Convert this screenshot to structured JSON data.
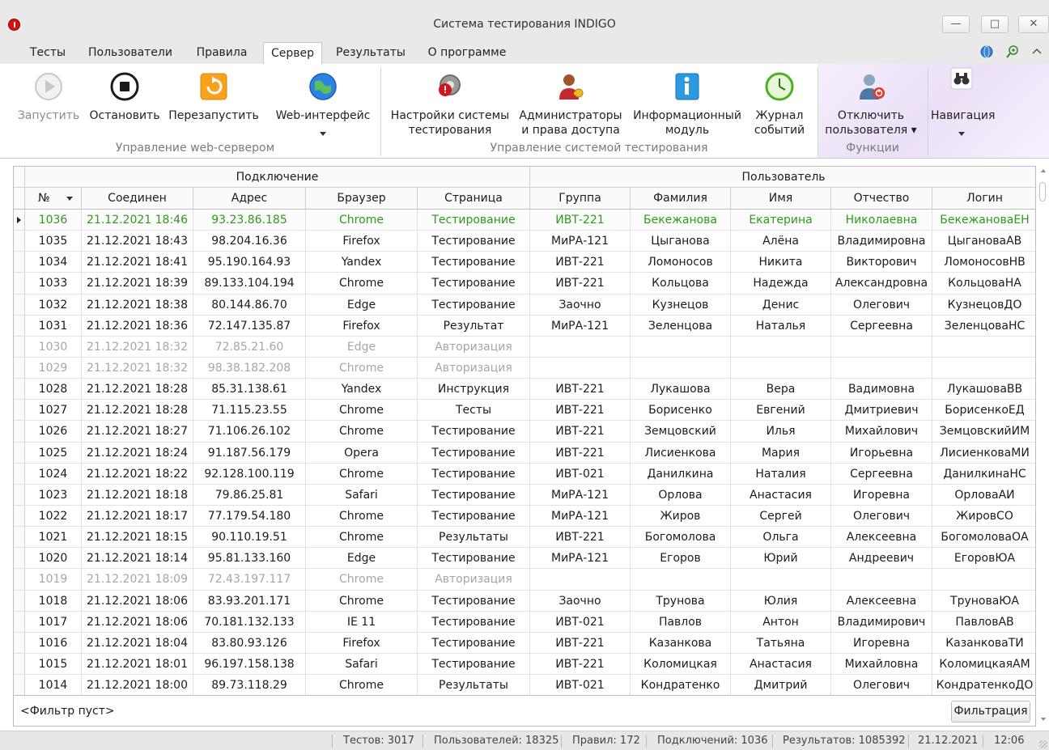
{
  "window": {
    "title": "Система тестирования INDIGO",
    "min_glyph": "—",
    "max_glyph": "□",
    "close_glyph": "✕"
  },
  "tabs": [
    {
      "label": "Тесты",
      "active": false
    },
    {
      "label": "Пользователи",
      "active": false
    },
    {
      "label": "Правила",
      "active": false
    },
    {
      "label": "Сервер",
      "active": true
    },
    {
      "label": "Результаты",
      "active": false
    },
    {
      "label": "О программе",
      "active": false
    }
  ],
  "ribbon": {
    "groups": {
      "web_server": "Управление web-сервером",
      "testing_system": "Управление системой тестирования",
      "functions": "Функции"
    },
    "buttons": {
      "start": "Запустить",
      "stop": "Остановить",
      "restart": "Перезапустить",
      "web": "Web-интерфейс",
      "settings_l1": "Настройки системы",
      "settings_l2": "тестирования",
      "admins_l1": "Администраторы",
      "admins_l2": "и права доступа",
      "info_l1": "Информационный",
      "info_l2": "модуль",
      "journal_l1": "Журнал",
      "journal_l2": "событий",
      "disconnect_l1": "Отключить",
      "disconnect_l2": "пользователя",
      "nav": "Навигация"
    },
    "icons": {
      "start": "play-icon",
      "stop": "stop-icon",
      "restart": "restart-icon",
      "web": "globe-icon",
      "settings": "settings-gear-icon",
      "admins": "admin-key-icon",
      "info": "info-icon",
      "journal": "clock-icon",
      "disconnect": "user-disconnect-icon",
      "nav": "binoculars-icon"
    }
  },
  "grid": {
    "bands": {
      "connection": "Подключение",
      "user": "Пользователь"
    },
    "columns": {
      "num": "№",
      "connected": "Соединен",
      "address": "Адрес",
      "browser": "Браузер",
      "page": "Страница",
      "group": "Группа",
      "surname": "Фамилия",
      "name": "Имя",
      "patronymic": "Отчество",
      "login": "Логин"
    },
    "rows": [
      {
        "state": "active",
        "num": "1036",
        "connected": "21.12.2021 18:46",
        "address": "93.23.86.185",
        "browser": "Chrome",
        "page": "Тестирование",
        "group": "ИВТ-221",
        "surname": "Бекежанова",
        "name": "Екатерина",
        "patronymic": "Николаевна",
        "login": "БекежановаЕН"
      },
      {
        "state": "normal",
        "num": "1035",
        "connected": "21.12.2021 18:43",
        "address": "98.204.16.36",
        "browser": "Firefox",
        "page": "Тестирование",
        "group": "МиРА-121",
        "surname": "Цыганова",
        "name": "Алёна",
        "patronymic": "Владимировна",
        "login": "ЦыгановаАВ"
      },
      {
        "state": "normal",
        "num": "1034",
        "connected": "21.12.2021 18:41",
        "address": "95.190.164.93",
        "browser": "Yandex",
        "page": "Тестирование",
        "group": "ИВТ-221",
        "surname": "Ломоносов",
        "name": "Никита",
        "patronymic": "Викторович",
        "login": "ЛомоносовНВ"
      },
      {
        "state": "normal",
        "num": "1033",
        "connected": "21.12.2021 18:39",
        "address": "89.133.104.194",
        "browser": "Chrome",
        "page": "Тестирование",
        "group": "ИВТ-221",
        "surname": "Кольцова",
        "name": "Надежда",
        "patronymic": "Александровна",
        "login": "КольцоваНА"
      },
      {
        "state": "normal",
        "num": "1032",
        "connected": "21.12.2021 18:38",
        "address": "80.144.86.70",
        "browser": "Edge",
        "page": "Тестирование",
        "group": "Заочно",
        "surname": "Кузнецов",
        "name": "Денис",
        "patronymic": "Олегович",
        "login": "КузнецовДО"
      },
      {
        "state": "normal",
        "num": "1031",
        "connected": "21.12.2021 18:36",
        "address": "72.147.135.87",
        "browser": "Firefox",
        "page": "Результат",
        "group": "МиРА-121",
        "surname": "Зеленцова",
        "name": "Наталья",
        "patronymic": "Сергеевна",
        "login": "ЗеленцоваНС"
      },
      {
        "state": "inactive",
        "num": "1030",
        "connected": "21.12.2021 18:32",
        "address": "72.85.21.60",
        "browser": "Edge",
        "page": "Авторизация",
        "group": "",
        "surname": "",
        "name": "",
        "patronymic": "",
        "login": ""
      },
      {
        "state": "inactive",
        "num": "1029",
        "connected": "21.12.2021 18:32",
        "address": "98.38.182.208",
        "browser": "Chrome",
        "page": "Авторизация",
        "group": "",
        "surname": "",
        "name": "",
        "patronymic": "",
        "login": ""
      },
      {
        "state": "normal",
        "num": "1028",
        "connected": "21.12.2021 18:28",
        "address": "85.31.138.61",
        "browser": "Yandex",
        "page": "Инструкция",
        "group": "ИВТ-221",
        "surname": "Лукашова",
        "name": "Вера",
        "patronymic": "Вадимовна",
        "login": "ЛукашоваВВ"
      },
      {
        "state": "normal",
        "num": "1027",
        "connected": "21.12.2021 18:28",
        "address": "71.115.23.55",
        "browser": "Chrome",
        "page": "Тесты",
        "group": "ИВТ-221",
        "surname": "Борисенко",
        "name": "Евгений",
        "patronymic": "Дмитриевич",
        "login": "БорисенкоЕД"
      },
      {
        "state": "normal",
        "num": "1026",
        "connected": "21.12.2021 18:27",
        "address": "71.106.26.102",
        "browser": "Chrome",
        "page": "Тестирование",
        "group": "ИВТ-221",
        "surname": "Земцовский",
        "name": "Илья",
        "patronymic": "Михайлович",
        "login": "ЗемцовскийИМ"
      },
      {
        "state": "normal",
        "num": "1025",
        "connected": "21.12.2021 18:24",
        "address": "91.187.56.179",
        "browser": "Opera",
        "page": "Тестирование",
        "group": "ИВТ-221",
        "surname": "Лисиенкова",
        "name": "Мария",
        "patronymic": "Игорьевна",
        "login": "ЛисиенковаМИ"
      },
      {
        "state": "normal",
        "num": "1024",
        "connected": "21.12.2021 18:22",
        "address": "92.128.100.119",
        "browser": "Chrome",
        "page": "Тестирование",
        "group": "ИВТ-021",
        "surname": "Данилкина",
        "name": "Наталия",
        "patronymic": "Сергеевна",
        "login": "ДанилкинаНС"
      },
      {
        "state": "normal",
        "num": "1023",
        "connected": "21.12.2021 18:18",
        "address": "79.86.25.81",
        "browser": "Safari",
        "page": "Тестирование",
        "group": "МиРА-121",
        "surname": "Орлова",
        "name": "Анастасия",
        "patronymic": "Игоревна",
        "login": "ОрловаАИ"
      },
      {
        "state": "normal",
        "num": "1022",
        "connected": "21.12.2021 18:17",
        "address": "77.179.54.180",
        "browser": "Chrome",
        "page": "Тестирование",
        "group": "МиРА-121",
        "surname": "Жиров",
        "name": "Сергей",
        "patronymic": "Олегович",
        "login": "ЖировСО"
      },
      {
        "state": "normal",
        "num": "1021",
        "connected": "21.12.2021 18:15",
        "address": "90.110.19.51",
        "browser": "Chrome",
        "page": "Результаты",
        "group": "ИВТ-221",
        "surname": "Богомолова",
        "name": "Ольга",
        "patronymic": "Алексеевна",
        "login": "БогомоловаОА"
      },
      {
        "state": "normal",
        "num": "1020",
        "connected": "21.12.2021 18:14",
        "address": "95.81.133.160",
        "browser": "Edge",
        "page": "Тестирование",
        "group": "МиРА-121",
        "surname": "Егоров",
        "name": "Юрий",
        "patronymic": "Андреевич",
        "login": "ЕгоровЮА"
      },
      {
        "state": "inactive",
        "num": "1019",
        "connected": "21.12.2021 18:09",
        "address": "72.43.197.117",
        "browser": "Chrome",
        "page": "Авторизация",
        "group": "",
        "surname": "",
        "name": "",
        "patronymic": "",
        "login": ""
      },
      {
        "state": "normal",
        "num": "1018",
        "connected": "21.12.2021 18:06",
        "address": "83.93.201.171",
        "browser": "Chrome",
        "page": "Тестирование",
        "group": "Заочно",
        "surname": "Трунова",
        "name": "Юлия",
        "patronymic": "Алексеевна",
        "login": "ТруноваЮА"
      },
      {
        "state": "normal",
        "num": "1017",
        "connected": "21.12.2021 18:06",
        "address": "70.181.132.133",
        "browser": "IE 11",
        "page": "Тестирование",
        "group": "ИВТ-021",
        "surname": "Павлов",
        "name": "Антон",
        "patronymic": "Владимирович",
        "login": "ПавловАВ"
      },
      {
        "state": "normal",
        "num": "1016",
        "connected": "21.12.2021 18:04",
        "address": "83.80.93.126",
        "browser": "Firefox",
        "page": "Тестирование",
        "group": "ИВТ-221",
        "surname": "Казанкова",
        "name": "Татьяна",
        "patronymic": "Игоревна",
        "login": "КазанковаТИ"
      },
      {
        "state": "normal",
        "num": "1015",
        "connected": "21.12.2021 18:01",
        "address": "96.197.158.138",
        "browser": "Safari",
        "page": "Тестирование",
        "group": "ИВТ-221",
        "surname": "Коломицкая",
        "name": "Анастасия",
        "patronymic": "Михайловна",
        "login": "КоломицкаяАМ"
      },
      {
        "state": "normal",
        "num": "1014",
        "connected": "21.12.2021 18:00",
        "address": "89.73.118.29",
        "browser": "Chrome",
        "page": "Результаты",
        "group": "ИВТ-021",
        "surname": "Кондратенко",
        "name": "Дмитрий",
        "patronymic": "Олегович",
        "login": "КондратенкоДО"
      }
    ]
  },
  "filter": {
    "text": "<Фильтр пуст>",
    "button": "Фильтрация"
  },
  "status": {
    "tests": "Тестов: 3017",
    "users": "Пользователей: 18325",
    "rules": "Правил: 172",
    "connections": "Подключений: 1036",
    "results": "Результатов: 1085392",
    "date": "21.12.2021",
    "time": "12:06"
  },
  "colors": {
    "active_row": "#2e9a19",
    "inactive_row": "#a6a6a6",
    "app_icon": "#e01010"
  }
}
